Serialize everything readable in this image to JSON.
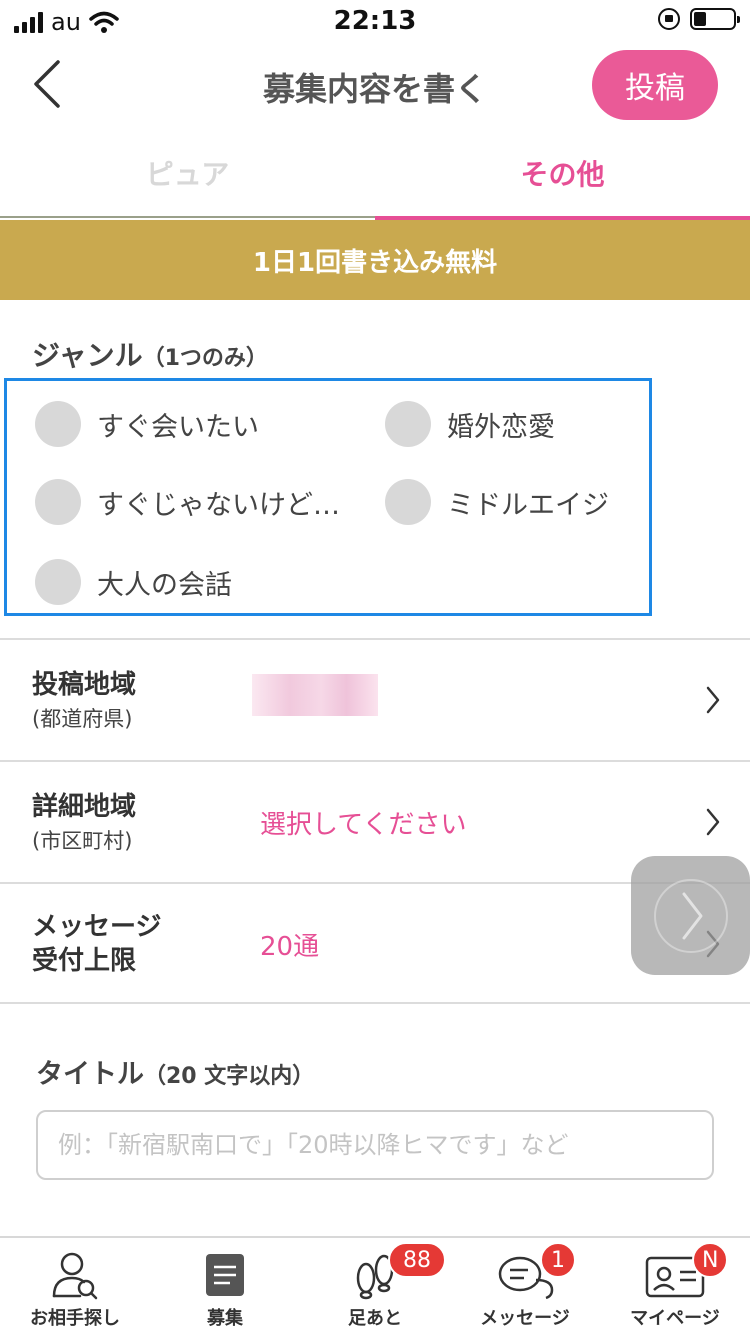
{
  "status_bar": {
    "carrier": "au",
    "time": "22:13"
  },
  "nav": {
    "title": "募集内容を書く",
    "post_button": "投稿"
  },
  "tabs": [
    {
      "label": "ピュア"
    },
    {
      "label": "その他"
    }
  ],
  "banner": "1日1回書き込み無料",
  "genre": {
    "title": "ジャンル",
    "note": "（1つのみ）",
    "options": [
      "すぐ会いたい",
      "婚外恋愛",
      "すぐじゃないけど…",
      "ミドルエイジ",
      "大人の会話"
    ]
  },
  "rows": {
    "area": {
      "label": "投稿地域",
      "sub": "(都道府県)"
    },
    "detail_area": {
      "label": "詳細地域",
      "sub": "(市区町村)",
      "value": "選択してください"
    },
    "message_limit": {
      "label_line1": "メッセージ",
      "label_line2": "受付上限",
      "value": "20通"
    }
  },
  "title_field": {
    "label": "タイトル",
    "note": "（20 文字以内）",
    "placeholder": "例：「新宿駅南口で」「20時以降ヒマです」など"
  },
  "tab_bar": [
    {
      "label": "お相手探し"
    },
    {
      "label": "募集"
    },
    {
      "label": "足あと",
      "badge": "88"
    },
    {
      "label": "メッセージ",
      "badge": "1"
    },
    {
      "label": "マイページ",
      "badge": "N"
    }
  ],
  "colors": {
    "accent": "#e64f95",
    "banner": "#c9a94f",
    "highlight_box": "#1e88e5",
    "badge": "#e53935"
  }
}
